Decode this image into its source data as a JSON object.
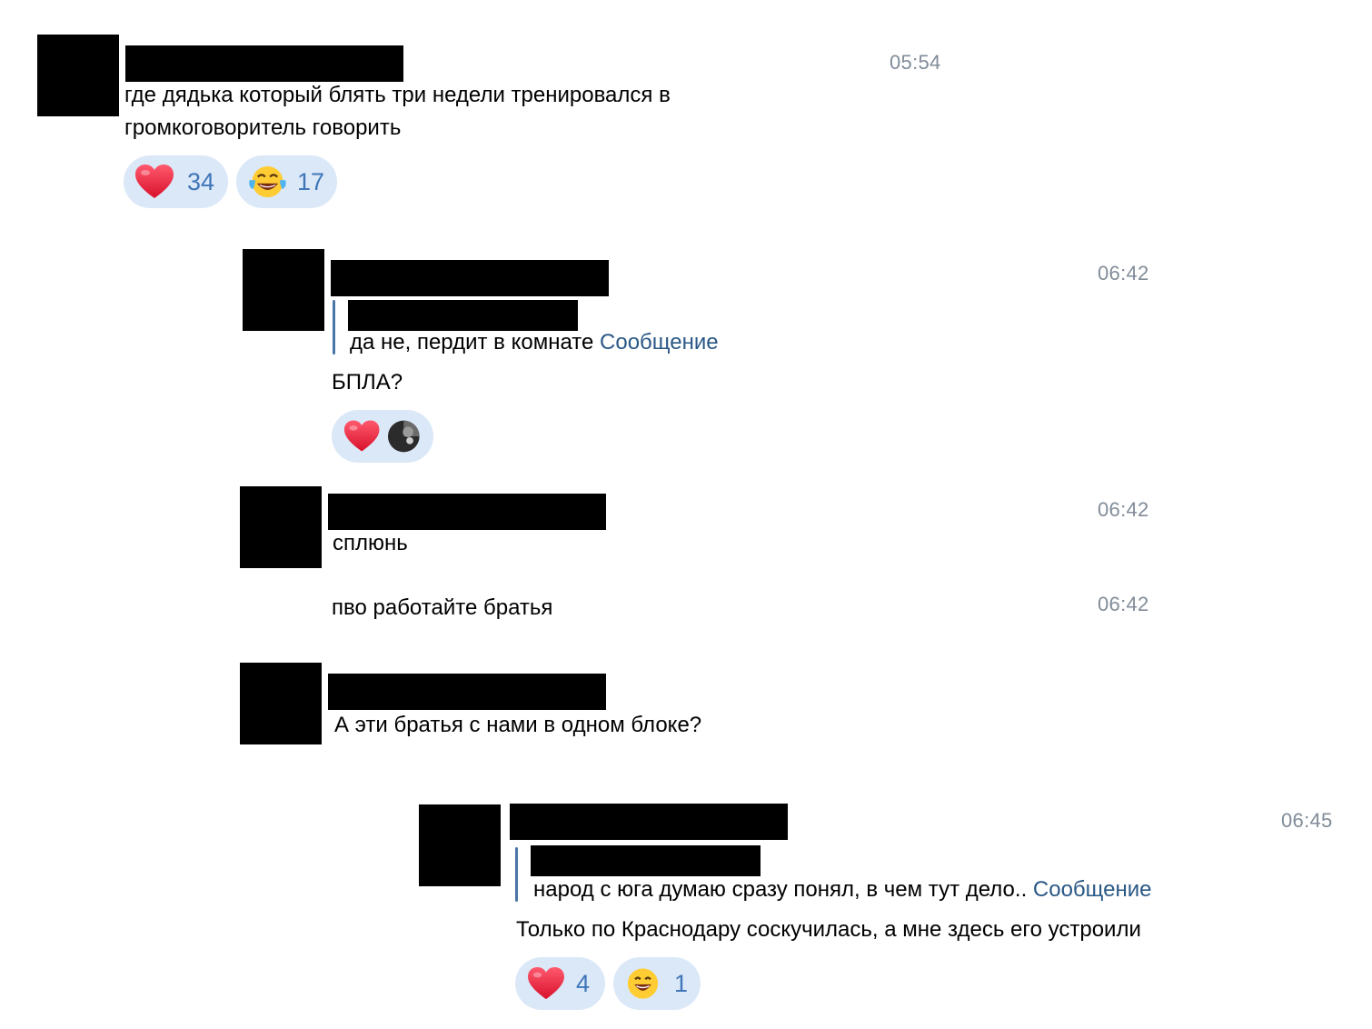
{
  "colors": {
    "reaction_bg": "#dbe8f8",
    "reaction_count": "#3f76b8",
    "timestamp": "#818c99",
    "quote_bar": "#4a76a8",
    "link": "#2a5885"
  },
  "messages": [
    {
      "time": "05:54",
      "text_lines": [
        "где дядька который блять три недели тренировался в",
        "громкоговоритель говорить"
      ],
      "reactions": [
        {
          "icon": "heart-icon",
          "count": "34"
        },
        {
          "icon": "tears-of-joy-icon",
          "count": "17"
        }
      ]
    },
    {
      "time": "06:42",
      "quote_text": "да не, пердит в комнате",
      "quote_link": "Сообщение",
      "text": "БПЛА?",
      "reactions": [
        {
          "icon": "heart-icon"
        },
        {
          "icon": "reactor-avatar-icon"
        }
      ]
    },
    {
      "time": "06:42",
      "text": "сплюнь"
    },
    {
      "time": "06:42",
      "text": "пво работайте братья"
    },
    {
      "text": "А эти братья с нами в одном блоке?"
    },
    {
      "time": "06:45",
      "quote_text": "народ с юга думаю сразу понял, в чем тут дело..",
      "quote_link": "Сообщение",
      "text": "Только по Краснодару соскучилась, а мне здесь его устроили",
      "reactions": [
        {
          "icon": "heart-icon",
          "count": "4"
        },
        {
          "icon": "grinning-face-icon",
          "count": "1"
        }
      ]
    }
  ]
}
